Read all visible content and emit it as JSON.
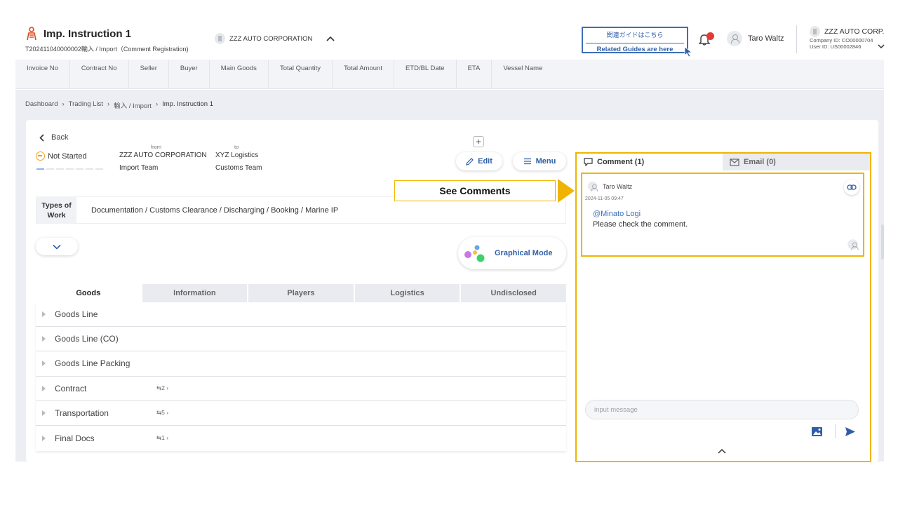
{
  "header": {
    "title": "Imp. Instruction 1",
    "subtitle": "T202411040000002輸入 / Import（Comment Registration)",
    "corporation": "ZZZ AUTO CORPORATION",
    "guide_jp": "関連ガイドはこちら",
    "guide_en": "Related Guides are here",
    "user_name": "Taro Waltz",
    "company_name": "ZZZ AUTO CORP.",
    "company_id": "Company ID: CO00000704",
    "user_id": "User ID: US00002846"
  },
  "infobar": {
    "columns": [
      "Invoice No",
      "Contract No",
      "Seller",
      "Buyer",
      "Main Goods",
      "Total Quantity",
      "Total Amount",
      "ETD/BL Date",
      "ETA",
      "Vessel Name"
    ]
  },
  "breadcrumb": {
    "items": [
      "Dashboard",
      "Trading List",
      "輸入 / Import",
      "Imp. Instruction 1"
    ],
    "separator": "›"
  },
  "detail": {
    "back_label": "Back",
    "status": "Not Started",
    "from_label": "from",
    "from_company": "ZZZ AUTO CORPORATION",
    "from_team": "Import Team",
    "to_label": "to",
    "to_company": "XYZ Logistics",
    "to_team": "Customs Team",
    "edit_label": "Edit",
    "menu_label": "Menu",
    "plus_label": "+",
    "types_of_work_label": "Types of Work",
    "types_of_work_value": "Documentation / Customs Clearance / Discharging / Booking / Marine IP",
    "graphical_mode_label": "Graphical Mode"
  },
  "tabs": [
    "Goods",
    "Information",
    "Players",
    "Logistics",
    "Undisclosed"
  ],
  "rows": [
    {
      "label": "Goods Line",
      "badge": ""
    },
    {
      "label": "Goods Line (CO)",
      "badge": ""
    },
    {
      "label": "Goods Line Packing",
      "badge": ""
    },
    {
      "label": "Contract",
      "badge": "⇆2 ›"
    },
    {
      "label": "Transportation",
      "badge": "⇆5 ›"
    },
    {
      "label": "Final Docs",
      "badge": "⇆1 ›"
    }
  ],
  "right_panel": {
    "comment_tab": "Comment (1)",
    "email_tab": "Email (0)",
    "comment_user": "Taro Waltz",
    "comment_date": "2024-11-05 09:47",
    "comment_mention": "@Minato Logi",
    "comment_text": "Please check the comment.",
    "input_placeholder": "input message"
  },
  "callout": {
    "label": "See Comments"
  },
  "colors": {
    "accent": "#2f5ea8",
    "highlight": "#f0b400",
    "notification": "#e53935",
    "status_not_started": "#f0a020"
  }
}
